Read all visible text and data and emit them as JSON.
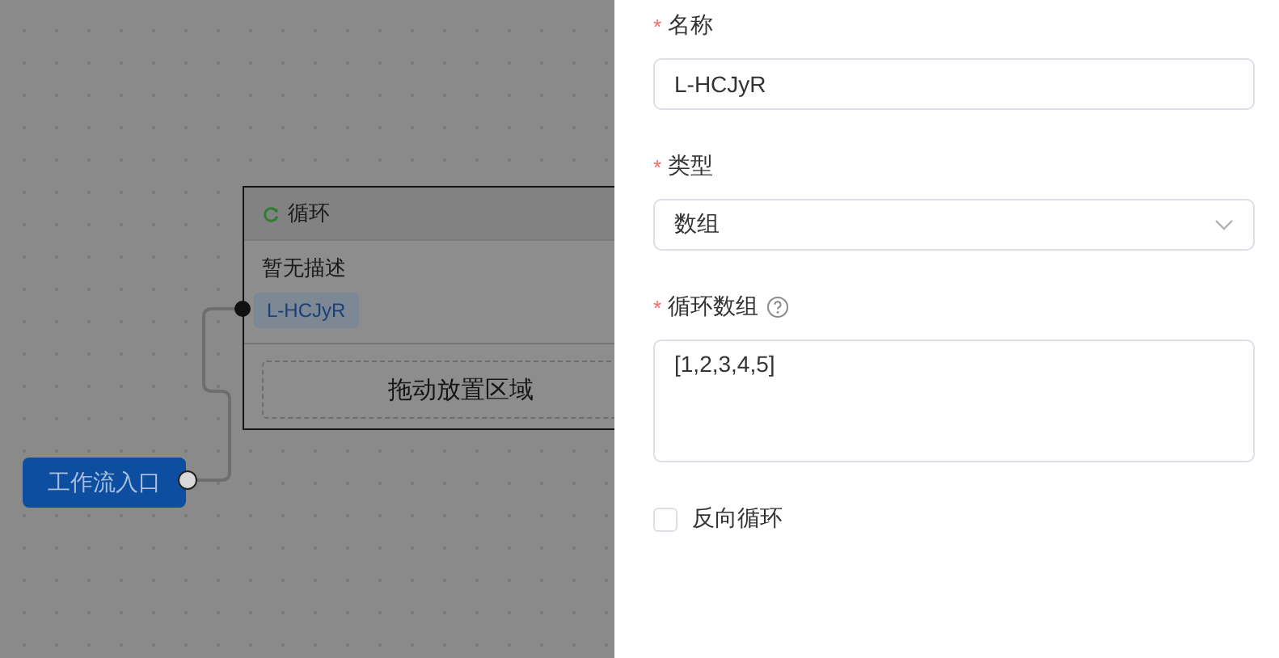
{
  "canvas": {
    "loop_node": {
      "title": "循环",
      "description": "暂无描述",
      "variable_tag": "L-HCJyR",
      "drop_zone": "拖动放置区域"
    },
    "entry_node": {
      "label": "工作流入口"
    }
  },
  "form": {
    "fields": [
      {
        "kind": "text",
        "required_mark": "*",
        "label": "名称",
        "value": "L-HCJyR"
      },
      {
        "kind": "select",
        "required_mark": "*",
        "label": "类型",
        "value": "数组"
      },
      {
        "kind": "textarea",
        "required_mark": "*",
        "label": "循环数组",
        "help": true,
        "value": "[1,2,3,4,5]"
      },
      {
        "kind": "checkbox",
        "label": "反向循环",
        "checked": false
      }
    ]
  }
}
